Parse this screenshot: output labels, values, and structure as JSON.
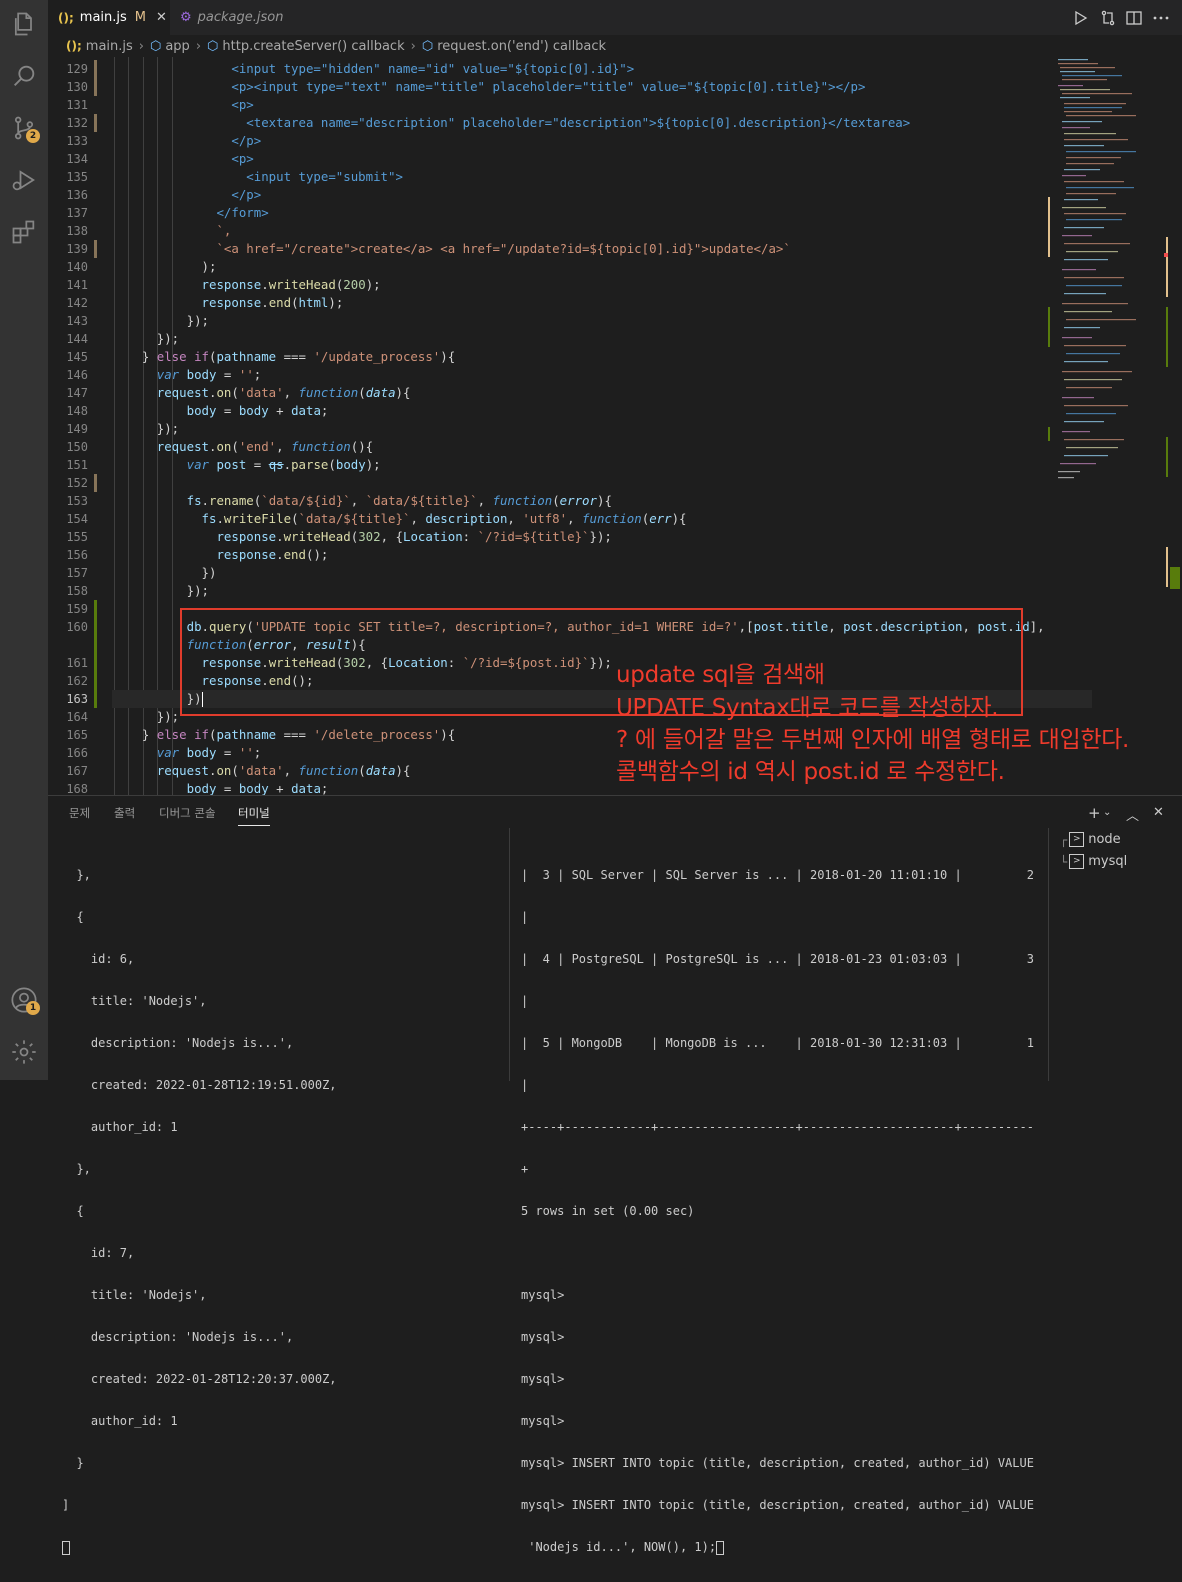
{
  "tabs": [
    {
      "icon": "();",
      "label": "main.js",
      "modified": "M",
      "close": "✕"
    },
    {
      "label": "package.json"
    }
  ],
  "breadcrumb": [
    "main.js",
    "app",
    "http.createServer() callback",
    "request.on('end') callback"
  ],
  "breadcrumb_icon": "();",
  "line_numbers": [
    "129",
    "130",
    "131",
    "132",
    "133",
    "134",
    "135",
    "136",
    "137",
    "138",
    "139",
    "140",
    "141",
    "142",
    "143",
    "144",
    "145",
    "146",
    "147",
    "148",
    "149",
    "150",
    "151",
    "152",
    "153",
    "154",
    "155",
    "156",
    "157",
    "158",
    "159",
    "160",
    "",
    "161",
    "162",
    "163",
    "164",
    "165",
    "166",
    "167",
    "168"
  ],
  "code": {
    "l129": [
      "<input type=\"hidden\" name=\"id\" value=\"${topic[0].id}\">"
    ],
    "l130": [
      "<p><input type=\"text\" name=\"title\" placeholder=\"title\" value=\"${topic[0].title}\"></p>"
    ],
    "l131": [
      "<p>"
    ],
    "l132": [
      "<textarea name=\"description\" placeholder=\"description\">${topic[0].description}</textarea>"
    ],
    "l133": [
      "</p>"
    ],
    "l134": [
      "<p>"
    ],
    "l135": [
      "<input type=\"submit\">"
    ],
    "l136": [
      "</p>"
    ],
    "l137": [
      "</form>"
    ],
    "l138": [
      "`,"
    ],
    "l139": [
      "`<a href=\"/create\">create</a> <a href=\"/update?id=${topic[0].id}\">update</a>`"
    ],
    "l140": [
      ");"
    ],
    "l141": [
      "response",
      ".",
      "writeHead",
      "(",
      "200",
      ");"
    ],
    "l142": [
      "response",
      ".",
      "end",
      "(",
      "html",
      ");"
    ],
    "l143": [
      "});"
    ],
    "l144": [
      "});"
    ],
    "l145": [
      "} ",
      "else if",
      "(",
      "pathname",
      " === ",
      "'/update_process'",
      "){"
    ],
    "l146": [
      "var",
      " ",
      "body",
      " = ",
      "''",
      ";"
    ],
    "l147": [
      "request",
      ".",
      "on",
      "(",
      "'data'",
      ", ",
      "function",
      "(",
      "data",
      "){"
    ],
    "l148": [
      "body",
      " = ",
      "body",
      " + ",
      "data",
      ";"
    ],
    "l149": [
      "});"
    ],
    "l150": [
      "request",
      ".",
      "on",
      "(",
      "'end'",
      ", ",
      "function",
      "(){"
    ],
    "l151": [
      "var",
      " ",
      "post",
      " = ",
      "qs",
      ".",
      "parse",
      "(",
      "body",
      ");"
    ],
    "l153": [
      "fs",
      ".",
      "rename",
      "(",
      "`data/${id}`",
      ", ",
      "`data/${title}`",
      ", ",
      "function",
      "(",
      "error",
      "){"
    ],
    "l154": [
      "fs",
      ".",
      "writeFile",
      "(",
      "`data/${title}`",
      ", ",
      "description",
      ", ",
      "'utf8'",
      ", ",
      "function",
      "(",
      "err",
      "){"
    ],
    "l155": [
      "response",
      ".",
      "writeHead",
      "(",
      "302",
      ", {",
      "Location",
      ": ",
      "`/?id=${title}`",
      "});"
    ],
    "l156": [
      "response",
      ".",
      "end",
      "();"
    ],
    "l157": [
      "})"
    ],
    "l158": [
      "});"
    ],
    "l160": [
      "db",
      ".",
      "query",
      "(",
      "'UPDATE topic SET title=?, description=?, author_id=1 WHERE id=?'",
      ",[",
      "post",
      ".",
      "title",
      ", ",
      "post",
      ".",
      "description",
      ", ",
      "post",
      ".",
      "id",
      "],"
    ],
    "l160b": [
      "function",
      "(",
      "error",
      ", ",
      "result",
      "){"
    ],
    "l161": [
      "response",
      ".",
      "writeHead",
      "(",
      "302",
      ", {",
      "Location",
      ": ",
      "`/?id=${post.id}`",
      "});"
    ],
    "l162": [
      "response",
      ".",
      "end",
      "();"
    ],
    "l163": [
      "})"
    ],
    "l164": [
      "});"
    ],
    "l165": [
      "} ",
      "else if",
      "(",
      "pathname",
      " === ",
      "'/delete_process'",
      "){"
    ],
    "l166": [
      "var",
      " ",
      "body",
      " = ",
      "''",
      ";"
    ],
    "l167": [
      "request",
      ".",
      "on",
      "(",
      "'data'",
      ", ",
      "function",
      "(",
      "data",
      "){"
    ],
    "l168": [
      "body",
      " = ",
      "body",
      " + ",
      "data",
      ";"
    ]
  },
  "annotation": [
    "update sql을 검색해",
    "UPDATE Syntax대로 코드를 작성하자.",
    "? 에 들어갈 말은 두번째 인자에 배열 형태로 대입한다.",
    " 콜백함수의 id 역시 post.id 로 수정한다."
  ],
  "panel_tabs": [
    "문제",
    "출력",
    "디버그 콘솔",
    "터미널"
  ],
  "terminal_left": [
    "  },",
    "  {",
    "    id: 6,",
    "    title: 'Nodejs',",
    "    description: 'Nodejs is...',",
    "    created: 2022-01-28T12:19:51.000Z,",
    "    author_id: 1",
    "  },",
    "  {",
    "    id: 7,",
    "    title: 'Nodejs',",
    "    description: 'Nodejs is...',",
    "    created: 2022-01-28T12:20:37.000Z,",
    "    author_id: 1",
    "  }",
    "]"
  ],
  "terminal_right": [
    "|  3 | SQL Server | SQL Server is ... | 2018-01-20 11:01:10 |         2",
    "|",
    "|  4 | PostgreSQL | PostgreSQL is ... | 2018-01-23 01:03:03 |         3",
    "|",
    "|  5 | MongoDB    | MongoDB is ...    | 2018-01-30 12:31:03 |         1",
    "|",
    "+----+------------+-------------------+---------------------+----------",
    "+",
    "5 rows in set (0.00 sec)",
    "",
    "mysql>",
    "mysql>",
    "mysql>",
    "mysql>",
    "mysql> INSERT INTO topic (title, description, created, author_id) VALUE",
    "mysql> INSERT INTO topic (title, description, created, author_id) VALUE",
    " 'Nodejs id...', NOW(), 1);"
  ],
  "terminals": [
    "node",
    "mysql"
  ],
  "badges": {
    "scm": "2",
    "accounts": "1"
  },
  "colors": {
    "accent": "#007acc",
    "annotation": "#e03c2c",
    "modified": "#e2c08d"
  }
}
